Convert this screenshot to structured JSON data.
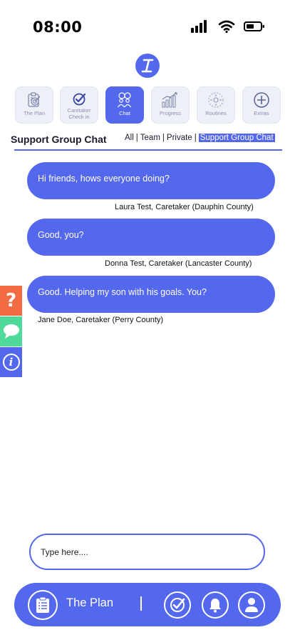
{
  "status_bar": {
    "time": "08:00"
  },
  "nav_tiles": [
    {
      "label": "The Plan",
      "icon": "clipboard-target-icon"
    },
    {
      "label": "Caretaker Check in",
      "icon": "check-circle-icon"
    },
    {
      "label": "Chat",
      "icon": "chat-people-icon",
      "active": true
    },
    {
      "label": "Progress",
      "icon": "bar-chart-icon"
    },
    {
      "label": "Routines",
      "icon": "routine-cycle-icon"
    },
    {
      "label": "Extras",
      "icon": "plus-circle-icon"
    }
  ],
  "chat": {
    "heading": "Support Group Chat",
    "filters": [
      "All",
      "Team",
      "Private",
      "Support Group Chat"
    ],
    "active_filter": "Support Group Chat"
  },
  "messages": [
    {
      "text": "Hi friends, hows everyone doing?",
      "sender": "Laura Test, Caretaker (Dauphin County)"
    },
    {
      "text": "Good, you?",
      "sender": "Donna Test, Caretaker (Lancaster County)"
    },
    {
      "text": "Good. Helping my son with his goals. You?",
      "sender": "Jane Doe, Caretaker (Perry County)"
    }
  ],
  "side_tabs": [
    {
      "icon": "help-question-icon",
      "color": "#f26b43",
      "glyph": "?"
    },
    {
      "icon": "chat-bubble-icon",
      "color": "#4fd99b"
    },
    {
      "icon": "info-icon",
      "color": "#5468ee",
      "glyph": "i"
    }
  ],
  "composer": {
    "placeholder": "Type here...."
  },
  "bottom_bar": {
    "plan_label": "The Plan"
  },
  "colors": {
    "accent": "#5468ee",
    "tile_bg": "#eef0f8",
    "help": "#f26b43",
    "chat": "#4fd99b"
  }
}
